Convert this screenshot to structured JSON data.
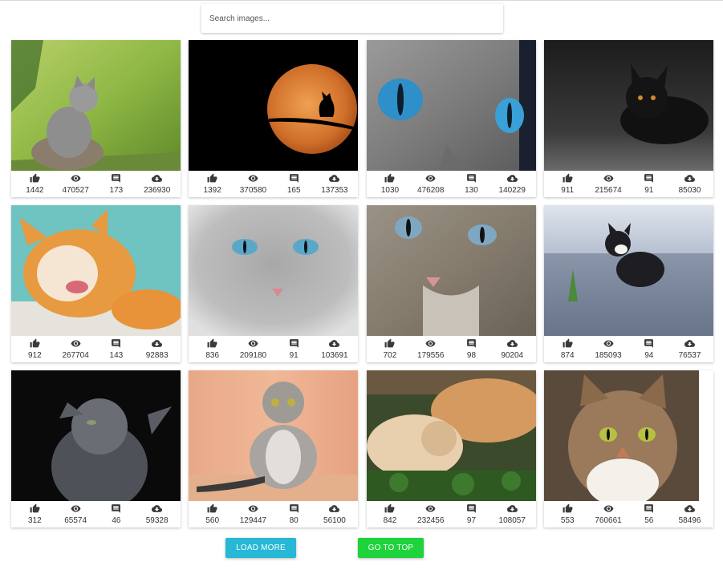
{
  "search": {
    "placeholder": "Search images..."
  },
  "cards": [
    {
      "image": "kitten-on-stump-photo",
      "likes": "1442",
      "views": "470527",
      "comments": "173",
      "downloads": "236930"
    },
    {
      "image": "cat-silhouette-moon-photo",
      "likes": "1392",
      "views": "370580",
      "comments": "165",
      "downloads": "137353"
    },
    {
      "image": "blue-eyed-cat-closeup-photo",
      "likes": "1030",
      "views": "476208",
      "comments": "130",
      "downloads": "140229"
    },
    {
      "image": "black-cat-photo",
      "likes": "911",
      "views": "215674",
      "comments": "91",
      "downloads": "85030"
    },
    {
      "image": "orange-cat-licking-photo",
      "likes": "912",
      "views": "267704",
      "comments": "143",
      "downloads": "92883"
    },
    {
      "image": "grey-fluffy-cat-photo",
      "likes": "836",
      "views": "209180",
      "comments": "91",
      "downloads": "103691"
    },
    {
      "image": "tabby-cat-face-photo",
      "likes": "702",
      "views": "179556",
      "comments": "98",
      "downloads": "90204"
    },
    {
      "image": "kitten-on-cobblestones-photo",
      "likes": "874",
      "views": "185093",
      "comments": "94",
      "downloads": "76537"
    },
    {
      "image": "grey-cat-looking-up-photo",
      "likes": "312",
      "views": "65574",
      "comments": "46",
      "downloads": "59328"
    },
    {
      "image": "scottish-fold-sitting-photo",
      "likes": "560",
      "views": "129447",
      "comments": "80",
      "downloads": "56100"
    },
    {
      "image": "cat-and-dog-cuddling-photo",
      "likes": "842",
      "views": "232456",
      "comments": "97",
      "downloads": "108057"
    },
    {
      "image": "tabby-cat-portrait-photo",
      "likes": "553",
      "views": "760661",
      "comments": "56",
      "downloads": "58496"
    }
  ],
  "buttons": {
    "load_more": "LOAD MORE",
    "go_to_top": "GO TO TOP"
  },
  "colors": {
    "load_more": "#26b8d4",
    "go_to_top": "#1ed33b",
    "icon": "#3a3a3a"
  },
  "icons": [
    "thumb-up-icon",
    "eye-icon",
    "comment-icon",
    "cloud-download-icon"
  ]
}
